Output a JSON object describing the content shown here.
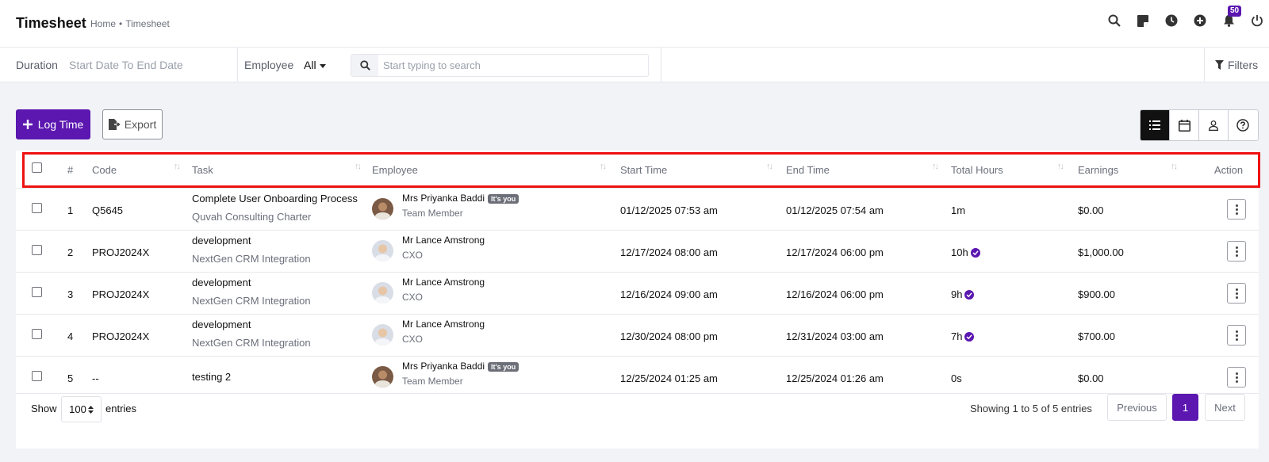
{
  "header": {
    "title": "Timesheet",
    "breadcrumb_home": "Home",
    "breadcrumb_sep": "•",
    "breadcrumb_current": "Timesheet",
    "notification_count": "50"
  },
  "filters": {
    "duration_label": "Duration",
    "duration_value": "Start Date To End Date",
    "employee_label": "Employee",
    "employee_value": "All",
    "search_placeholder": "Start typing to search",
    "filters_label": "Filters"
  },
  "actions": {
    "log_time": "Log Time",
    "export": "Export"
  },
  "table": {
    "columns": [
      "#",
      "Code",
      "Task",
      "Employee",
      "Start Time",
      "End Time",
      "Total Hours",
      "Earnings",
      "Action"
    ],
    "rows": [
      {
        "num": "1",
        "code": "Q5645",
        "task": "Complete User Onboarding Process",
        "project": "Quvah Consulting Charter",
        "employee": "Mrs Priyanka Baddi",
        "role": "Team Member",
        "you": "It's you",
        "start": "01/12/2025 07:53 am",
        "end": "01/12/2025 07:54 am",
        "hours": "1m",
        "approved": false,
        "earnings": "$0.00"
      },
      {
        "num": "2",
        "code": "PROJ2024X",
        "task": "development",
        "project": "NextGen CRM Integration",
        "employee": "Mr Lance Amstrong",
        "role": "CXO",
        "you": "",
        "start": "12/17/2024 08:00 am",
        "end": "12/17/2024 06:00 pm",
        "hours": "10h",
        "approved": true,
        "earnings": "$1,000.00"
      },
      {
        "num": "3",
        "code": "PROJ2024X",
        "task": "development",
        "project": "NextGen CRM Integration",
        "employee": "Mr Lance Amstrong",
        "role": "CXO",
        "you": "",
        "start": "12/16/2024 09:00 am",
        "end": "12/16/2024 06:00 pm",
        "hours": "9h",
        "approved": true,
        "earnings": "$900.00"
      },
      {
        "num": "4",
        "code": "PROJ2024X",
        "task": "development",
        "project": "NextGen CRM Integration",
        "employee": "Mr Lance Amstrong",
        "role": "CXO",
        "you": "",
        "start": "12/30/2024 08:00 pm",
        "end": "12/31/2024 03:00 am",
        "hours": "7h",
        "approved": true,
        "earnings": "$700.00"
      },
      {
        "num": "5",
        "code": "--",
        "task": "testing 2",
        "project": "",
        "employee": "Mrs Priyanka Baddi",
        "role": "Team Member",
        "you": "It's you",
        "start": "12/25/2024 01:25 am",
        "end": "12/25/2024 01:26 am",
        "hours": "0s",
        "approved": false,
        "earnings": "$0.00"
      }
    ]
  },
  "footer": {
    "show_label": "Show",
    "entries_value": "100",
    "entries_label": "entries",
    "showing_text": "Showing 1 to 5 of 5 entries",
    "previous": "Previous",
    "current_page": "1",
    "next": "Next"
  },
  "colors": {
    "accent": "#5b17b0",
    "highlight": "#ee1111"
  }
}
